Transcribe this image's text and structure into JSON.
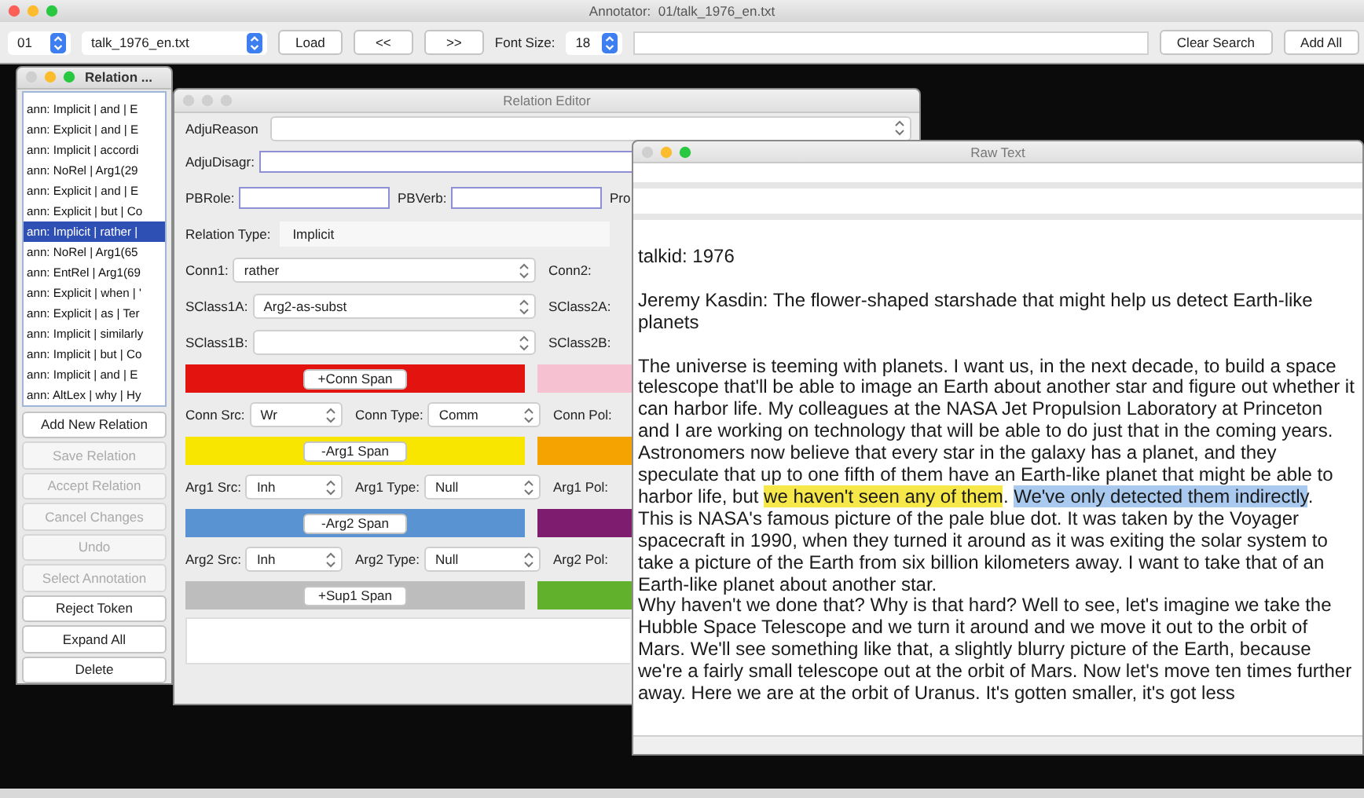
{
  "window": {
    "title": "Annotator:  01/talk_1976_en.txt"
  },
  "toolbar": [
    {
      "kind": "combo",
      "value": "01"
    },
    {
      "kind": "combo",
      "value": "talk_1976_en.txt"
    },
    {
      "kind": "button",
      "label": "Load"
    },
    {
      "kind": "button",
      "label": "<<"
    },
    {
      "kind": "button",
      "label": ">>"
    },
    {
      "kind": "label",
      "text": "Font Size:"
    },
    {
      "kind": "combo",
      "value": "18"
    },
    {
      "kind": "search"
    },
    {
      "kind": "button",
      "label": "Clear Search"
    },
    {
      "kind": "button",
      "label": "Add All"
    }
  ],
  "relation_list": {
    "title": "Relation ...",
    "items": [
      {
        "text": "ann: Implicit | and | E",
        "selected": false
      },
      {
        "text": "ann: Explicit | and | E",
        "selected": false
      },
      {
        "text": "ann: Implicit | accordi",
        "selected": false
      },
      {
        "text": "ann: NoRel | Arg1(29",
        "selected": false
      },
      {
        "text": "ann: Explicit | and | E",
        "selected": false
      },
      {
        "text": "ann: Explicit | but | Co",
        "selected": false
      },
      {
        "text": "ann: Implicit | rather |",
        "selected": true
      },
      {
        "text": "ann: NoRel | Arg1(65",
        "selected": false
      },
      {
        "text": "ann: EntRel | Arg1(69",
        "selected": false
      },
      {
        "text": "ann: Explicit | when | '",
        "selected": false
      },
      {
        "text": "ann: Explicit | as | Ter",
        "selected": false
      },
      {
        "text": "ann: Implicit | similarly",
        "selected": false
      },
      {
        "text": "ann: Implicit | but | Co",
        "selected": false
      },
      {
        "text": "ann: Implicit | and | E",
        "selected": false
      },
      {
        "text": "ann: AltLex | why | Hy",
        "selected": false
      }
    ],
    "buttons": [
      {
        "label": "Add New Relation",
        "disabled": false
      },
      {
        "label": "Save Relation",
        "disabled": true
      },
      {
        "label": "Accept Relation",
        "disabled": true
      },
      {
        "label": "Cancel Changes",
        "disabled": true
      },
      {
        "label": "Undo",
        "disabled": true
      },
      {
        "label": "Select Annotation",
        "disabled": true
      },
      {
        "label": "Reject Token",
        "disabled": false
      },
      {
        "label": "Expand All",
        "disabled": false
      },
      {
        "label": "Delete",
        "disabled": false
      }
    ]
  },
  "relation_editor": {
    "title": "Relation Editor",
    "rows": [
      {
        "kind": "combo-wide",
        "label": "AdjuReason"
      },
      {
        "kind": "text-wide",
        "label": "AdjuDisagr:"
      },
      {
        "kind": "text-fields",
        "items": [
          {
            "label": "PBRole:"
          },
          {
            "label": "PBVerb:"
          },
          {
            "label": "Pro"
          }
        ]
      },
      {
        "kind": "static",
        "label": "Relation Type:",
        "value": "Implicit"
      },
      {
        "kind": "combos",
        "items": [
          {
            "label": "Conn1:",
            "value": "rather"
          },
          {
            "label": "Conn2:"
          }
        ]
      },
      {
        "kind": "combos",
        "items": [
          {
            "label": "SClass1A:",
            "value": "Arg2-as-subst"
          },
          {
            "label": "SClass2A:"
          }
        ]
      },
      {
        "kind": "combos",
        "items": [
          {
            "label": "SClass1B:"
          },
          {
            "label": "SClass2B:"
          }
        ]
      },
      {
        "kind": "spans",
        "items": [
          {
            "color": "#e3140f",
            "button": "+Conn Span"
          },
          {
            "color": "#f6c2d2"
          }
        ]
      },
      {
        "kind": "combos",
        "items": [
          {
            "label": "Conn Src:",
            "value": "Wr"
          },
          {
            "label": "Conn Type:",
            "value": "Comm"
          },
          {
            "label": "Conn Pol:"
          }
        ]
      },
      {
        "kind": "spans",
        "items": [
          {
            "color": "#f8e600",
            "button": "-Arg1 Span"
          },
          {
            "color": "#f5a300"
          }
        ]
      },
      {
        "kind": "combos",
        "items": [
          {
            "label": "Arg1 Src:",
            "value": "Inh"
          },
          {
            "label": "Arg1 Type:",
            "value": "Null"
          },
          {
            "label": "Arg1 Pol:"
          }
        ]
      },
      {
        "kind": "spans",
        "items": [
          {
            "color": "#5a93d2",
            "button": "-Arg2 Span"
          },
          {
            "color": "#7e1c70"
          }
        ]
      },
      {
        "kind": "combos",
        "items": [
          {
            "label": "Arg2 Src:",
            "value": "Inh"
          },
          {
            "label": "Arg2 Type:",
            "value": "Null"
          },
          {
            "label": "Arg2 Pol:"
          }
        ]
      },
      {
        "kind": "spans",
        "items": [
          {
            "color": "#bdbdbd",
            "button": "+Sup1 Span"
          },
          {
            "color": "#62b12c"
          }
        ]
      },
      {
        "kind": "notes"
      }
    ]
  },
  "raw_text": {
    "title": "Raw Text",
    "paragraphs": [
      {
        "blank_line_after": true,
        "segments": [
          {
            "text": "talkid: 1976"
          }
        ]
      },
      {
        "blank_line_after": true,
        "segments": [
          {
            "text": "Jeremy Kasdin: The flower-shaped starshade that might help us detect Earth-like planets"
          }
        ]
      },
      {
        "blank_line_after": false,
        "segments": [
          {
            "text": "The universe is teeming with planets. I want us, in the next decade, to build a space telescope that'll be able to image an Earth about another star and figure out whether it can harbor life. My colleagues at the NASA Jet Propulsion Laboratory at Princeton and I are working on technology that will be able to do just that in the coming years. Astronomers now believe that every star in the galaxy has a planet, and they speculate that up to one fifth of them have an Earth-like planet that might be able to harbor life, but "
          },
          {
            "text": "we haven't seen any of them",
            "color": "#f7e84a"
          },
          {
            "text": ". "
          },
          {
            "text": "We've only detected them indirectly",
            "color": "#a9c9ee"
          },
          {
            "text": "."
          }
        ]
      },
      {
        "blank_line_after": false,
        "segments": [
          {
            "text": "This is NASA's famous picture of the pale blue dot. It was taken by the Voyager spacecraft in 1990, when they turned it around as it was exiting the solar system to take a picture of the Earth from six billion kilometers away. I want to take that of an Earth-like planet about another star."
          }
        ]
      },
      {
        "blank_line_after": false,
        "segments": [
          {
            "text": "Why haven't we done that? Why is that hard? Well to see, let's imagine we take the Hubble Space Telescope and we turn it around and we move it out to the orbit of Mars. We'll see something like that, a slightly blurry picture of the Earth, because we're a fairly small telescope out at the orbit of Mars. Now let's move ten times further away. Here we are at the orbit of Uranus. It's gotten smaller, it's got less"
          }
        ]
      }
    ]
  }
}
